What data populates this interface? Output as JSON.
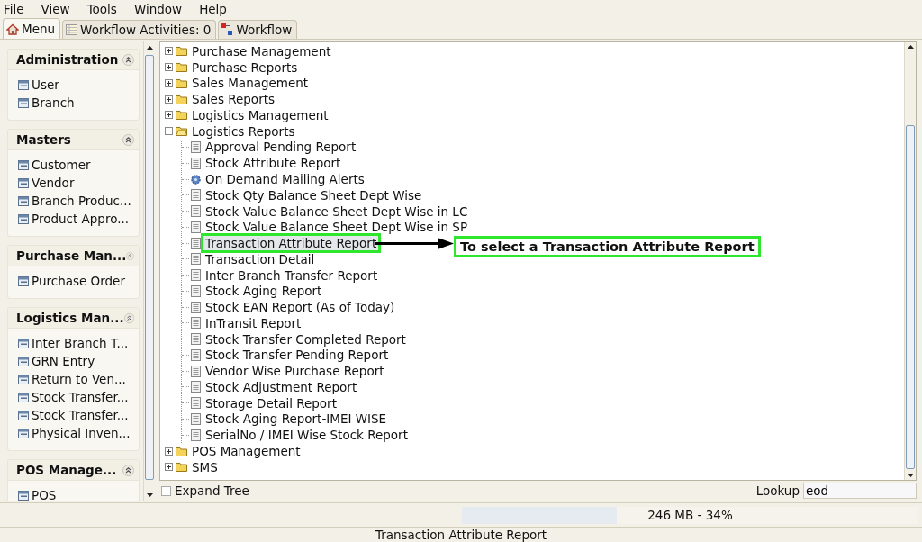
{
  "menu_bar": [
    "File",
    "View",
    "Tools",
    "Window",
    "Help"
  ],
  "tabs": [
    {
      "label": "Menu",
      "selected": true
    },
    {
      "label": "Workflow Activities: 0",
      "selected": false
    },
    {
      "label": "Workflow",
      "selected": false
    }
  ],
  "sidebar": {
    "sections": [
      {
        "title": "Administration",
        "items": [
          "User",
          "Branch"
        ]
      },
      {
        "title": "Masters",
        "items": [
          "Customer",
          "Vendor",
          "Branch Produc...",
          "Product Appro..."
        ]
      },
      {
        "title": "Purchase Man...",
        "items": [
          "Purchase Order"
        ]
      },
      {
        "title": "Logistics Man...",
        "items": [
          "Inter Branch T...",
          "GRN Entry",
          "Return to Ven...",
          "Stock Transfer...",
          "Stock Transfer...",
          "Physical Inven..."
        ]
      },
      {
        "title": "POS Manage...",
        "items": [
          "POS"
        ]
      }
    ]
  },
  "tree": [
    {
      "kind": "folder",
      "label": "Purchase Management",
      "expanded": false
    },
    {
      "kind": "folder",
      "label": "Purchase Reports",
      "expanded": false
    },
    {
      "kind": "folder",
      "label": "Sales Management",
      "expanded": false
    },
    {
      "kind": "folder",
      "label": "Sales Reports",
      "expanded": false
    },
    {
      "kind": "folder",
      "label": "Logistics Management",
      "expanded": false
    },
    {
      "kind": "folder",
      "label": "Logistics Reports",
      "expanded": true,
      "children": [
        {
          "kind": "report",
          "label": "Approval Pending Report",
          "selected": false
        },
        {
          "kind": "report",
          "label": "Stock Attribute Report",
          "selected": false
        },
        {
          "kind": "alert",
          "label": "On Demand Mailing Alerts",
          "selected": false
        },
        {
          "kind": "report",
          "label": "Stock Qty Balance Sheet Dept Wise",
          "selected": false
        },
        {
          "kind": "report",
          "label": "Stock Value Balance Sheet Dept Wise in LC",
          "selected": false
        },
        {
          "kind": "report",
          "label": "Stock Value Balance Sheet Dept Wise in SP",
          "selected": false
        },
        {
          "kind": "report",
          "label": "Transaction Attribute Report",
          "selected": true
        },
        {
          "kind": "report",
          "label": "Transaction Detail",
          "selected": false
        },
        {
          "kind": "report",
          "label": "Inter Branch Transfer Report",
          "selected": false
        },
        {
          "kind": "report",
          "label": "Stock Aging Report",
          "selected": false
        },
        {
          "kind": "report",
          "label": "Stock EAN Report (As of Today)",
          "selected": false
        },
        {
          "kind": "report",
          "label": "InTransit Report",
          "selected": false
        },
        {
          "kind": "report",
          "label": "Stock Transfer Completed Report",
          "selected": false
        },
        {
          "kind": "report",
          "label": "Stock Transfer Pending Report",
          "selected": false
        },
        {
          "kind": "report",
          "label": "Vendor Wise Purchase Report",
          "selected": false
        },
        {
          "kind": "report",
          "label": "Stock Adjustment Report",
          "selected": false
        },
        {
          "kind": "report",
          "label": "Storage Detail Report",
          "selected": false
        },
        {
          "kind": "report",
          "label": "Stock Aging Report-IMEI WISE",
          "selected": false
        },
        {
          "kind": "report",
          "label": "SerialNo / IMEI Wise Stock Report",
          "selected": false
        }
      ]
    },
    {
      "kind": "folder",
      "label": "POS Management",
      "expanded": false
    },
    {
      "kind": "folder",
      "label": "SMS",
      "expanded": false
    }
  ],
  "callout": "To select a Transaction Attribute Report",
  "expand_tree": {
    "label": "Expand Tree",
    "checked": false
  },
  "lookup": {
    "label": "Lookup",
    "value": "eod"
  },
  "memory": {
    "text": "246 MB - 34%",
    "level": 0.34
  },
  "status_text": "Transaction Attribute Report"
}
